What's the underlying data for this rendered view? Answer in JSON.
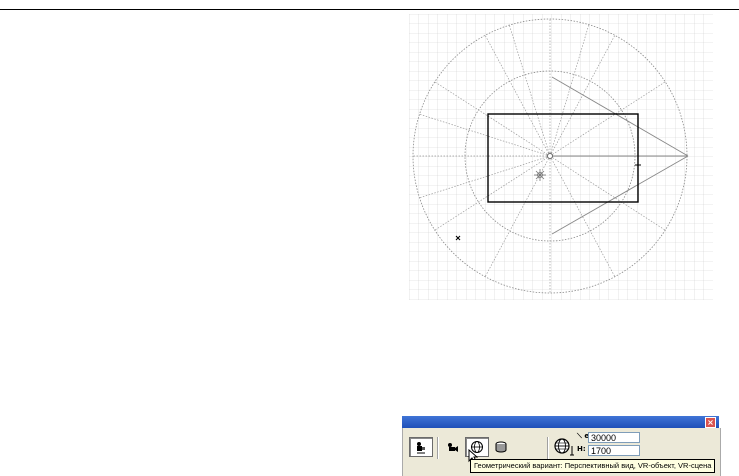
{
  "window": {
    "close_glyph": "×"
  },
  "toolbar": {
    "buttons": [
      {
        "name": "camera-view-icon",
        "active": true
      },
      {
        "name": "movie-camera-icon",
        "active": false
      },
      {
        "name": "globe-view-icon",
        "active": true
      },
      {
        "name": "cylinder-icon",
        "active": false
      }
    ],
    "globe_measure_icon": "globe-measure-icon",
    "field_top": {
      "label": "⟍ e:",
      "value": "30000"
    },
    "field_bottom": {
      "label": "H:",
      "value": "1700"
    }
  },
  "tooltip": {
    "text": "Геометрический вариант: Перспективный вид, VR-объект, VR-сцена"
  },
  "colors": {
    "grid": "#d0d0d0",
    "dotted": "#888888",
    "frame": "#000000",
    "titlebar": "#2a5cc8",
    "panel": "#ece9d8"
  }
}
